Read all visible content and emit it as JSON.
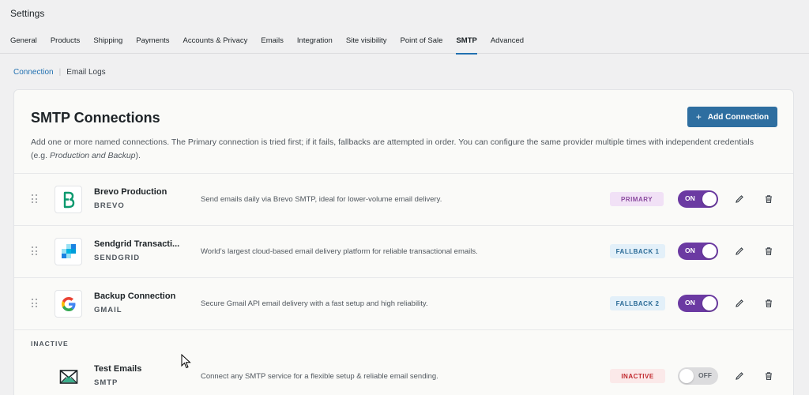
{
  "header": {
    "title": "Settings"
  },
  "tabs": [
    {
      "label": "General",
      "active": false
    },
    {
      "label": "Products",
      "active": false
    },
    {
      "label": "Shipping",
      "active": false
    },
    {
      "label": "Payments",
      "active": false
    },
    {
      "label": "Accounts & Privacy",
      "active": false
    },
    {
      "label": "Emails",
      "active": false
    },
    {
      "label": "Integration",
      "active": false
    },
    {
      "label": "Site visibility",
      "active": false
    },
    {
      "label": "Point of Sale",
      "active": false
    },
    {
      "label": "SMTP",
      "active": true
    },
    {
      "label": "Advanced",
      "active": false
    }
  ],
  "subnav": {
    "active": "Connection",
    "other": "Email Logs",
    "separator": "|"
  },
  "card": {
    "title": "SMTP Connections",
    "add_label": "Add Connection",
    "add_icon": "+",
    "desc_prefix": "Add one or more named connections. The Primary connection is tried first; if it fails, fallbacks are attempted in order. You can configure the same provider multiple times with independent credentials (e.g. ",
    "desc_italic": "Production and Backup",
    "desc_suffix": ")."
  },
  "connections": [
    {
      "name": "Brevo Production",
      "provider": "BREVO",
      "desc": "Send emails daily via Brevo SMTP, ideal for lower-volume email delivery.",
      "badge": "PRIMARY",
      "toggle": "ON",
      "icon": "brevo-logo-icon"
    },
    {
      "name": "Sendgrid Transacti...",
      "provider": "SENDGRID",
      "desc": "World’s largest cloud-based email delivery platform for reliable transactional emails.",
      "badge": "FALLBACK 1",
      "toggle": "ON",
      "icon": "sendgrid-logo-icon"
    },
    {
      "name": "Backup Connection",
      "provider": "GMAIL",
      "desc": "Secure Gmail API email delivery with a fast setup and high reliability.",
      "badge": "FALLBACK 2",
      "toggle": "ON",
      "icon": "google-logo-icon"
    }
  ],
  "inactive_section": {
    "label": "INACTIVE",
    "connections": [
      {
        "name": "Test Emails",
        "provider": "SMTP",
        "desc": "Connect any SMTP service for a flexible setup & reliable email sending.",
        "badge": "INACTIVE",
        "toggle": "OFF",
        "icon": "smtp-envelope-icon"
      }
    ]
  },
  "colors": {
    "accent": "#2271b1",
    "button": "#2e6ea0",
    "toggle_on": "#6b3aa2",
    "brevo": "#0b996e"
  }
}
